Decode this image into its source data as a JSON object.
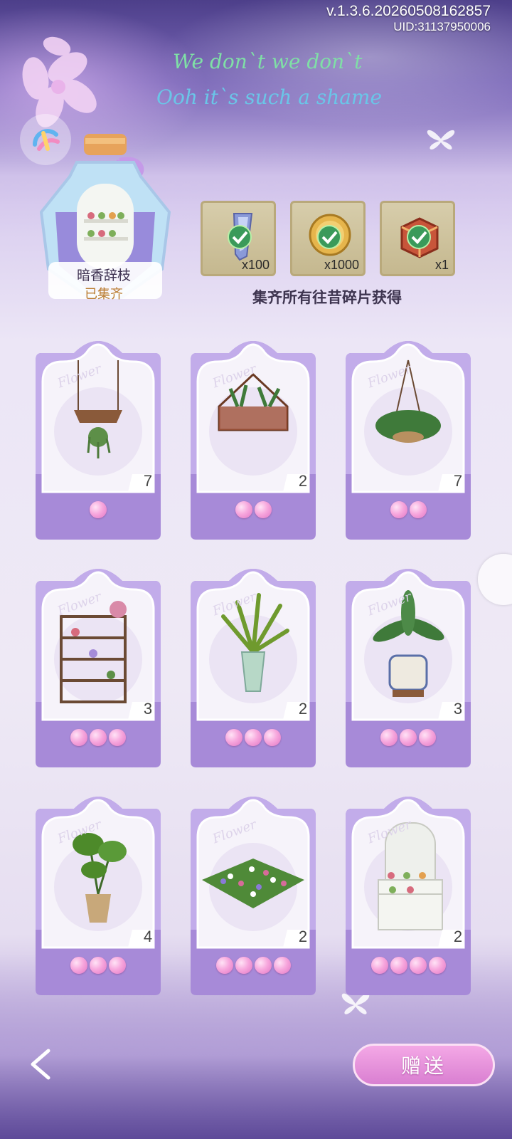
{
  "header": {
    "version": "v.1.3.6.20260508162857",
    "uid": "UID:31137950006",
    "lyric_line1": "We don`t we don`t",
    "lyric_line2": "Ooh it`s such a shame"
  },
  "collection": {
    "name": "暗香辞枝",
    "status": "已集齐"
  },
  "rewards": {
    "items": [
      {
        "icon": "crystal-quill-icon",
        "count": "x100",
        "claimed": true
      },
      {
        "icon": "clover-coin-icon",
        "count": "x1000",
        "claimed": true
      },
      {
        "icon": "treasure-box-icon",
        "count": "x1",
        "claimed": true
      }
    ],
    "caption": "集齐所有往昔碎片获得"
  },
  "cards": [
    {
      "icon": "hanging-shelf-planter-icon",
      "count": "7",
      "stars": 1
    },
    {
      "icon": "glass-terrarium-icon",
      "count": "2",
      "stars": 2
    },
    {
      "icon": "hanging-fern-basket-icon",
      "count": "7",
      "stars": 2
    },
    {
      "icon": "flower-display-shelf-icon",
      "count": "3",
      "stars": 3
    },
    {
      "icon": "potted-dracaena-icon",
      "count": "2",
      "stars": 3
    },
    {
      "icon": "potted-aglaonema-icon",
      "count": "3",
      "stars": 3
    },
    {
      "icon": "potted-monstera-icon",
      "count": "4",
      "stars": 3
    },
    {
      "icon": "flower-bed-icon",
      "count": "2",
      "stars": 4
    },
    {
      "icon": "white-plant-cabinet-icon",
      "count": "2",
      "stars": 4
    }
  ],
  "card_watermark": "Flower",
  "footer": {
    "gift_label": "赠送"
  },
  "colors": {
    "accent_purple": "#9b7fd6",
    "pearl_pink": "#f7a7dd",
    "button_pink": "#e08fd8"
  }
}
